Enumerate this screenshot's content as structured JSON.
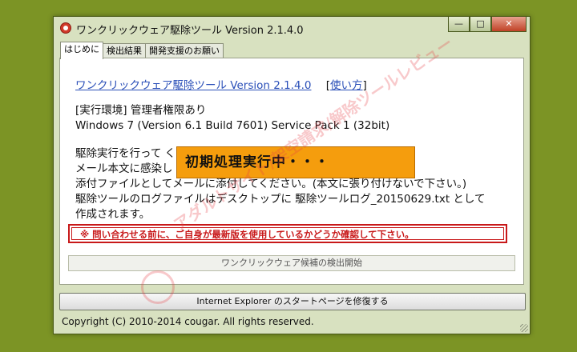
{
  "window": {
    "title": "ワンクリックウェア駆除ツール  Version 2.1.4.0",
    "controls": {
      "minimize": "—",
      "maximize": "□",
      "close": "✕"
    }
  },
  "tabs": [
    "はじめに",
    "検出結果",
    "開発支援のお願い"
  ],
  "panel": {
    "headline_link": "ワンクリックウェア駆除ツール Version 2.1.4.0",
    "usage_open": "[",
    "usage_link": "使い方",
    "usage_close": "]",
    "env_line1": "[実行環境] 管理者権限あり",
    "env_line2": "Windows 7 (Version 6.1 Build 7601) Service Pack 1 (32bit)",
    "desc_lines": [
      "駆除実行を行って                                       ください。",
      "メール本文に感染し                                    のログファイルを",
      "添付ファイルとしてメールに添付してください。(本文に張り付けないで下さい。)",
      "駆除ツールのログファイルはデスクトップに 駆除ツールログ_20150629.txt として",
      "作成されます。"
    ],
    "warning": "※ 問い合わせる前に、ご自身が最新版を使用しているかどうか確認して下さい。",
    "scan_button": "ワンクリックウェア候補の検出開始"
  },
  "ie_button": "Internet Explorer のスタートページを修復する",
  "status": "Copyright (C) 2010-2014 cougar. All rights reserved.",
  "overlay_text": "初期処理実行中・・・",
  "watermark_text": "アダルトサイト/架空請求/解除ツールレビュー"
}
